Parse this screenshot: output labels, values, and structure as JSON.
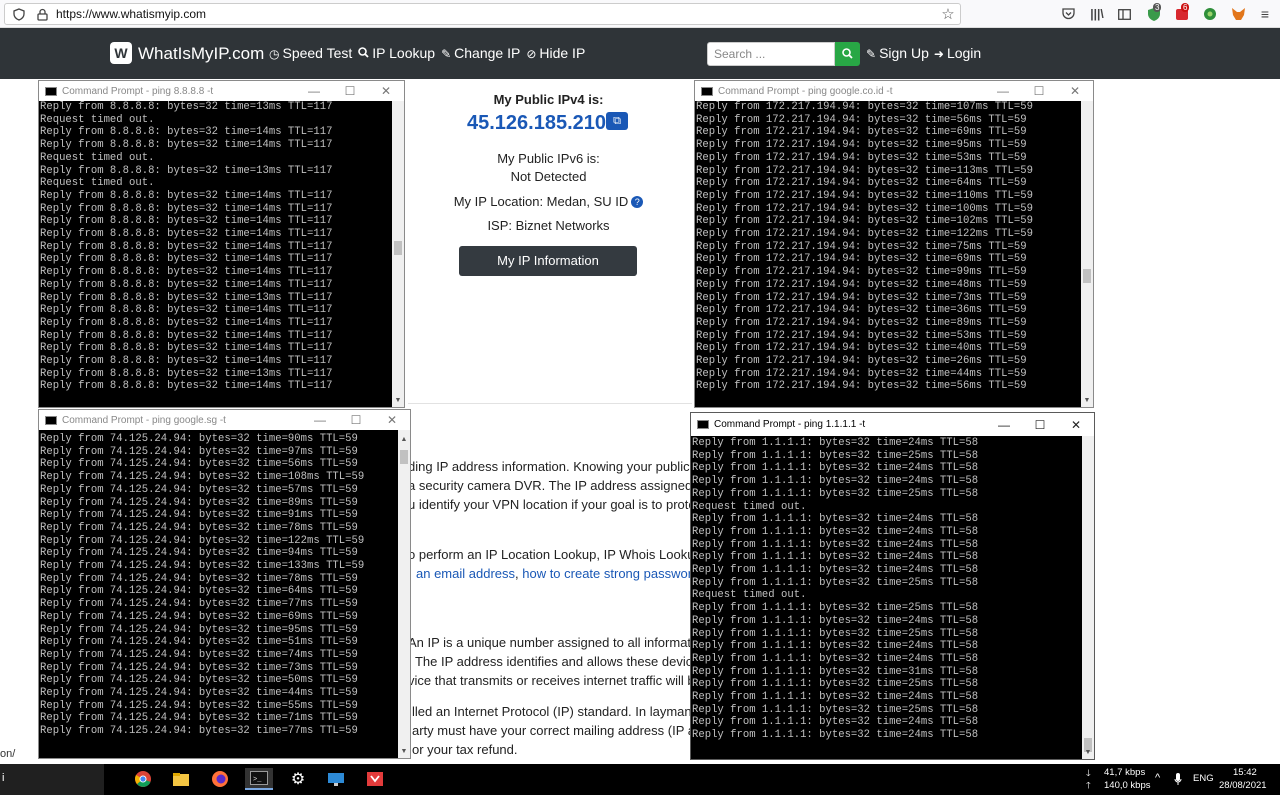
{
  "browser": {
    "url": "https://www.whatismyip.com",
    "ext_badge_1": "3",
    "ext_badge_2": "6"
  },
  "nav": {
    "logo_text": "WhatIsMyIP.com",
    "items": [
      "Speed Test",
      "IP Lookup",
      "Change IP",
      "Hide IP"
    ],
    "search_placeholder": "Search ...",
    "signup": "Sign Up",
    "login": "Login"
  },
  "ipinfo": {
    "ipv4_label": "My Public IPv4 is:",
    "ipv4": "45.126.185.210",
    "ipv6_label": "My Public IPv6 is:",
    "ipv6": "Not Detected",
    "location": "My IP Location: Medan, SU ID",
    "isp": "ISP: Biznet Networks",
    "button": "My IP Information"
  },
  "article": {
    "p1": [
      "ding IP address information. Knowing your public I",
      "a security camera DVR. The IP address assigned to",
      "u identify your VPN location if your goal is to prote"
    ],
    "p2_line1": "o perform an IP Location Lookup, IP Whois Lookup",
    "p2_link1": "an email address",
    "p2_sep": ", ",
    "p2_link2": "how to create strong passwords",
    "p3": [
      "An IP is a unique number assigned to all informatio",
      ". The IP address identifies and allows these devices",
      "vice that transmits or receives internet traffic will b"
    ],
    "p4": [
      "lled an Internet Protocol (IP) standard. In laymans",
      "arty must have your correct mailing address (IP add",
      "or your tax refund."
    ],
    "edge_fragment": "on/"
  },
  "windows": [
    {
      "title": "Command Prompt - ping  8.8.8.8 -t",
      "lines": [
        "Reply from 8.8.8.8: bytes=32 time=13ms TTL=117",
        "Request timed out.",
        "Reply from 8.8.8.8: bytes=32 time=14ms TTL=117",
        "Reply from 8.8.8.8: bytes=32 time=14ms TTL=117",
        "Request timed out.",
        "Reply from 8.8.8.8: bytes=32 time=13ms TTL=117",
        "Request timed out.",
        "Reply from 8.8.8.8: bytes=32 time=14ms TTL=117",
        "Reply from 8.8.8.8: bytes=32 time=14ms TTL=117",
        "Reply from 8.8.8.8: bytes=32 time=14ms TTL=117",
        "Reply from 8.8.8.8: bytes=32 time=14ms TTL=117",
        "Reply from 8.8.8.8: bytes=32 time=14ms TTL=117",
        "Reply from 8.8.8.8: bytes=32 time=14ms TTL=117",
        "Reply from 8.8.8.8: bytes=32 time=14ms TTL=117",
        "Reply from 8.8.8.8: bytes=32 time=14ms TTL=117",
        "Reply from 8.8.8.8: bytes=32 time=13ms TTL=117",
        "Reply from 8.8.8.8: bytes=32 time=14ms TTL=117",
        "Reply from 8.8.8.8: bytes=32 time=14ms TTL=117",
        "Reply from 8.8.8.8: bytes=32 time=14ms TTL=117",
        "Reply from 8.8.8.8: bytes=32 time=14ms TTL=117",
        "Reply from 8.8.8.8: bytes=32 time=14ms TTL=117",
        "Reply from 8.8.8.8: bytes=32 time=13ms TTL=117",
        "Reply from 8.8.8.8: bytes=32 time=14ms TTL=117"
      ]
    },
    {
      "title": "Command Prompt - ping  google.co.id -t",
      "lines": [
        "Reply from 172.217.194.94: bytes=32 time=107ms TTL=59",
        "Reply from 172.217.194.94: bytes=32 time=56ms TTL=59",
        "Reply from 172.217.194.94: bytes=32 time=69ms TTL=59",
        "Reply from 172.217.194.94: bytes=32 time=95ms TTL=59",
        "Reply from 172.217.194.94: bytes=32 time=53ms TTL=59",
        "Reply from 172.217.194.94: bytes=32 time=113ms TTL=59",
        "Reply from 172.217.194.94: bytes=32 time=64ms TTL=59",
        "Reply from 172.217.194.94: bytes=32 time=110ms TTL=59",
        "Reply from 172.217.194.94: bytes=32 time=100ms TTL=59",
        "Reply from 172.217.194.94: bytes=32 time=102ms TTL=59",
        "Reply from 172.217.194.94: bytes=32 time=122ms TTL=59",
        "Reply from 172.217.194.94: bytes=32 time=75ms TTL=59",
        "Reply from 172.217.194.94: bytes=32 time=69ms TTL=59",
        "Reply from 172.217.194.94: bytes=32 time=99ms TTL=59",
        "Reply from 172.217.194.94: bytes=32 time=48ms TTL=59",
        "Reply from 172.217.194.94: bytes=32 time=73ms TTL=59",
        "Reply from 172.217.194.94: bytes=32 time=36ms TTL=59",
        "Reply from 172.217.194.94: bytes=32 time=89ms TTL=59",
        "Reply from 172.217.194.94: bytes=32 time=53ms TTL=59",
        "Reply from 172.217.194.94: bytes=32 time=40ms TTL=59",
        "Reply from 172.217.194.94: bytes=32 time=26ms TTL=59",
        "Reply from 172.217.194.94: bytes=32 time=44ms TTL=59",
        "Reply from 172.217.194.94: bytes=32 time=56ms TTL=59"
      ]
    },
    {
      "title": "Command Prompt - ping  google.sg -t",
      "lines": [
        "Reply from 74.125.24.94: bytes=32 time=90ms TTL=59",
        "Reply from 74.125.24.94: bytes=32 time=97ms TTL=59",
        "Reply from 74.125.24.94: bytes=32 time=56ms TTL=59",
        "Reply from 74.125.24.94: bytes=32 time=108ms TTL=59",
        "Reply from 74.125.24.94: bytes=32 time=57ms TTL=59",
        "Reply from 74.125.24.94: bytes=32 time=89ms TTL=59",
        "Reply from 74.125.24.94: bytes=32 time=91ms TTL=59",
        "Reply from 74.125.24.94: bytes=32 time=78ms TTL=59",
        "Reply from 74.125.24.94: bytes=32 time=122ms TTL=59",
        "Reply from 74.125.24.94: bytes=32 time=94ms TTL=59",
        "Reply from 74.125.24.94: bytes=32 time=133ms TTL=59",
        "Reply from 74.125.24.94: bytes=32 time=78ms TTL=59",
        "Reply from 74.125.24.94: bytes=32 time=64ms TTL=59",
        "Reply from 74.125.24.94: bytes=32 time=77ms TTL=59",
        "Reply from 74.125.24.94: bytes=32 time=69ms TTL=59",
        "Reply from 74.125.24.94: bytes=32 time=95ms TTL=59",
        "Reply from 74.125.24.94: bytes=32 time=51ms TTL=59",
        "Reply from 74.125.24.94: bytes=32 time=74ms TTL=59",
        "Reply from 74.125.24.94: bytes=32 time=73ms TTL=59",
        "Reply from 74.125.24.94: bytes=32 time=50ms TTL=59",
        "Reply from 74.125.24.94: bytes=32 time=44ms TTL=59",
        "Reply from 74.125.24.94: bytes=32 time=55ms TTL=59",
        "Reply from 74.125.24.94: bytes=32 time=71ms TTL=59",
        "Reply from 74.125.24.94: bytes=32 time=77ms TTL=59"
      ]
    },
    {
      "title": "Command Prompt - ping  1.1.1.1 -t",
      "lines": [
        "Reply from 1.1.1.1: bytes=32 time=24ms TTL=58",
        "Reply from 1.1.1.1: bytes=32 time=25ms TTL=58",
        "Reply from 1.1.1.1: bytes=32 time=24ms TTL=58",
        "Reply from 1.1.1.1: bytes=32 time=24ms TTL=58",
        "Reply from 1.1.1.1: bytes=32 time=25ms TTL=58",
        "Request timed out.",
        "Reply from 1.1.1.1: bytes=32 time=24ms TTL=58",
        "Reply from 1.1.1.1: bytes=32 time=24ms TTL=58",
        "Reply from 1.1.1.1: bytes=32 time=24ms TTL=58",
        "Reply from 1.1.1.1: bytes=32 time=24ms TTL=58",
        "Reply from 1.1.1.1: bytes=32 time=24ms TTL=58",
        "Reply from 1.1.1.1: bytes=32 time=25ms TTL=58",
        "Request timed out.",
        "Reply from 1.1.1.1: bytes=32 time=25ms TTL=58",
        "Reply from 1.1.1.1: bytes=32 time=24ms TTL=58",
        "Reply from 1.1.1.1: bytes=32 time=25ms TTL=58",
        "Reply from 1.1.1.1: bytes=32 time=24ms TTL=58",
        "Reply from 1.1.1.1: bytes=32 time=24ms TTL=58",
        "Reply from 1.1.1.1: bytes=32 time=31ms TTL=58",
        "Reply from 1.1.1.1: bytes=32 time=25ms TTL=58",
        "Reply from 1.1.1.1: bytes=32 time=24ms TTL=58",
        "Reply from 1.1.1.1: bytes=32 time=25ms TTL=58",
        "Reply from 1.1.1.1: bytes=32 time=24ms TTL=58",
        "Reply from 1.1.1.1: bytes=32 time=24ms TTL=58"
      ]
    }
  ],
  "taskbar": {
    "net_up": "41,7 kbps",
    "net_down": "140,0 kbps",
    "lang": "ENG",
    "time": "15:42",
    "date": "28/08/2021",
    "left_fragment": "i"
  }
}
